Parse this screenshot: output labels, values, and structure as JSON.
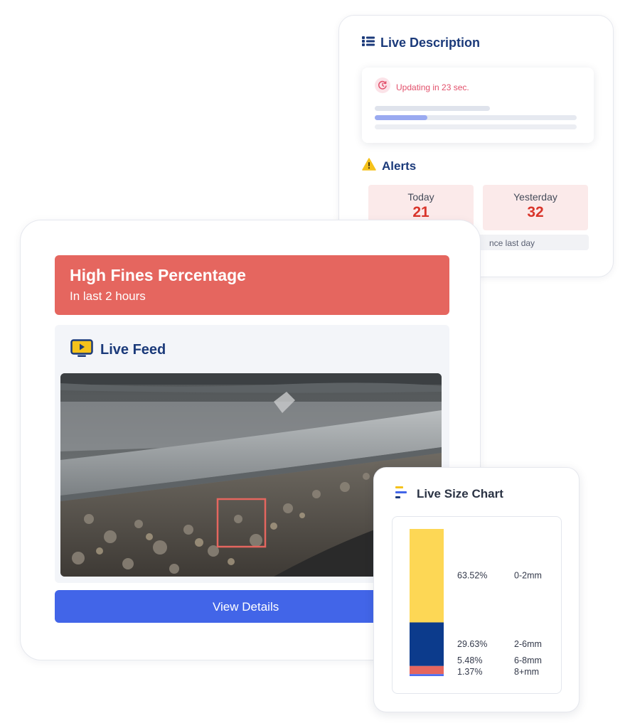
{
  "colors": {
    "banner": "#e5665f",
    "navy": "#1b3a7a",
    "button": "#4265e8",
    "alert_bg": "#fbeaea",
    "alert_value": "#d9352b",
    "update_text": "#e2506b"
  },
  "live_description": {
    "title": "Live Description",
    "icon": "list-icon",
    "updating_text": "Updating in 23 sec.",
    "updating_icon": "refresh-timer-icon",
    "progress": 0.26
  },
  "alerts": {
    "title": "Alerts",
    "icon": "warning-icon",
    "today_label": "Today",
    "today_value": "21",
    "yesterday_label": "Yesterday",
    "yesterday_value": "32",
    "since_text": "nce last day"
  },
  "banner": {
    "title": "High Fines Percentage",
    "subtitle": "In last 2 hours"
  },
  "live_feed": {
    "title": "Live Feed",
    "icon": "monitor-play-icon"
  },
  "button": {
    "view_details": "View Details"
  },
  "size_chart": {
    "title": "Live Size Chart",
    "icon": "bar-lines-icon"
  },
  "chart_data": {
    "type": "bar",
    "stacked": true,
    "title": "Live Size Chart",
    "categories": [
      "0-2mm",
      "2-6mm",
      "6-8mm",
      "8+mm"
    ],
    "values": [
      63.52,
      29.63,
      5.48,
      1.37
    ],
    "labels": [
      "63.52%",
      "29.63%",
      "5.48%",
      "1.37%"
    ],
    "colors": [
      "#fdd755",
      "#0c3b8c",
      "#e5665f",
      "#4c6ef0"
    ]
  }
}
